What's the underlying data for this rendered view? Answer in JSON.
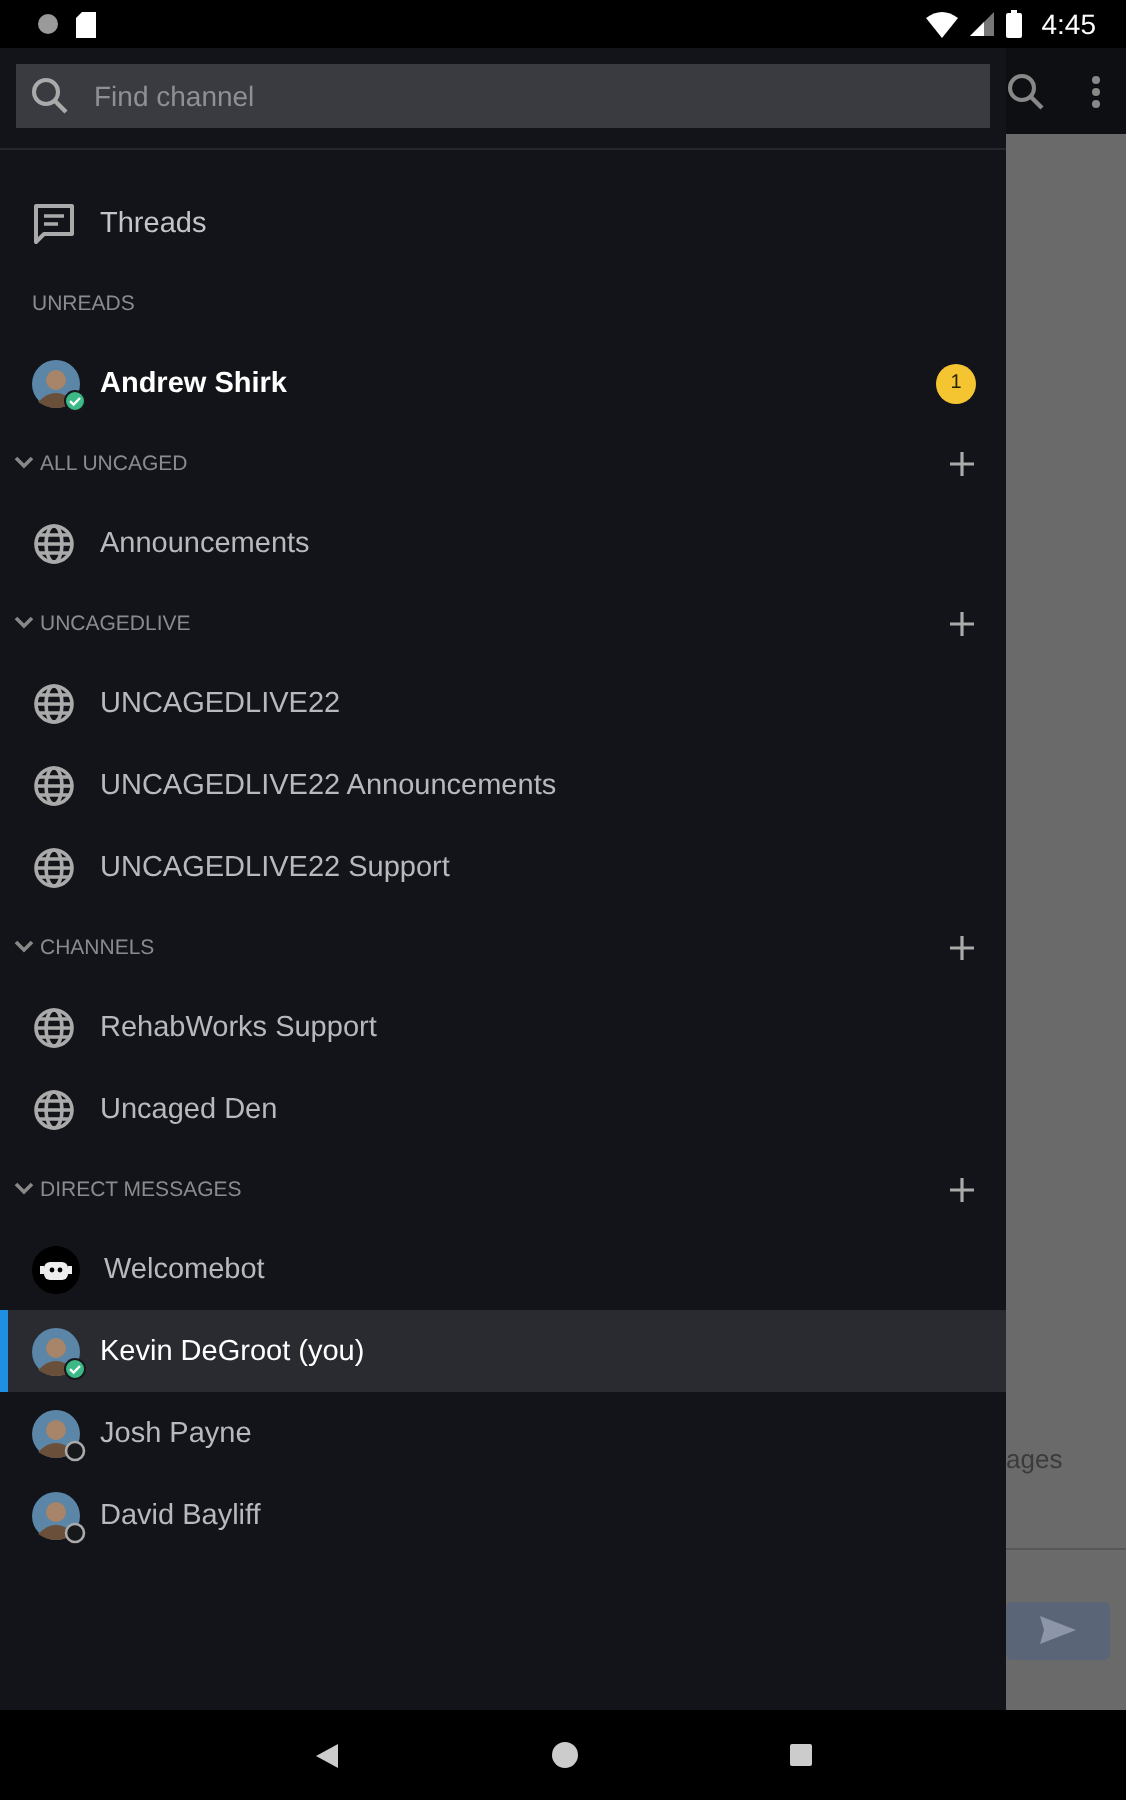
{
  "status_bar": {
    "time": "4:45"
  },
  "search": {
    "placeholder": "Find channel"
  },
  "threads": {
    "label": "Threads"
  },
  "sections": [
    {
      "title": "UNREADS",
      "collapsible": false,
      "can_add": false,
      "items": [
        {
          "kind": "user",
          "name": "Andrew Shirk",
          "online": true,
          "unread": true,
          "badge": "1",
          "selected": false
        }
      ]
    },
    {
      "title": "ALL UNCAGED",
      "collapsible": true,
      "can_add": true,
      "items": [
        {
          "kind": "channel",
          "name": "Announcements",
          "unread": false,
          "selected": false
        }
      ]
    },
    {
      "title": "UNCAGEDLIVE",
      "collapsible": true,
      "can_add": true,
      "items": [
        {
          "kind": "channel",
          "name": "UNCAGEDLIVE22",
          "unread": false,
          "selected": false
        },
        {
          "kind": "channel",
          "name": "UNCAGEDLIVE22 Announcements",
          "unread": false,
          "selected": false
        },
        {
          "kind": "channel",
          "name": "UNCAGEDLIVE22 Support",
          "unread": false,
          "selected": false
        }
      ]
    },
    {
      "title": "CHANNELS",
      "collapsible": true,
      "can_add": true,
      "items": [
        {
          "kind": "channel",
          "name": "RehabWorks Support",
          "unread": false,
          "selected": false
        },
        {
          "kind": "channel",
          "name": "Uncaged Den",
          "unread": false,
          "selected": false
        }
      ]
    },
    {
      "title": "DIRECT MESSAGES",
      "collapsible": true,
      "can_add": true,
      "items": [
        {
          "kind": "bot",
          "name": "Welcomebot",
          "unread": false,
          "selected": false
        },
        {
          "kind": "user",
          "name": "Kevin DeGroot (you)",
          "online": true,
          "unread": false,
          "selected": true
        },
        {
          "kind": "user",
          "name": "Josh Payne",
          "online": false,
          "unread": false,
          "selected": false
        },
        {
          "kind": "user",
          "name": "David Bayliff",
          "online": false,
          "unread": false,
          "selected": false
        }
      ]
    }
  ],
  "background": {
    "partial_text": "ages"
  }
}
